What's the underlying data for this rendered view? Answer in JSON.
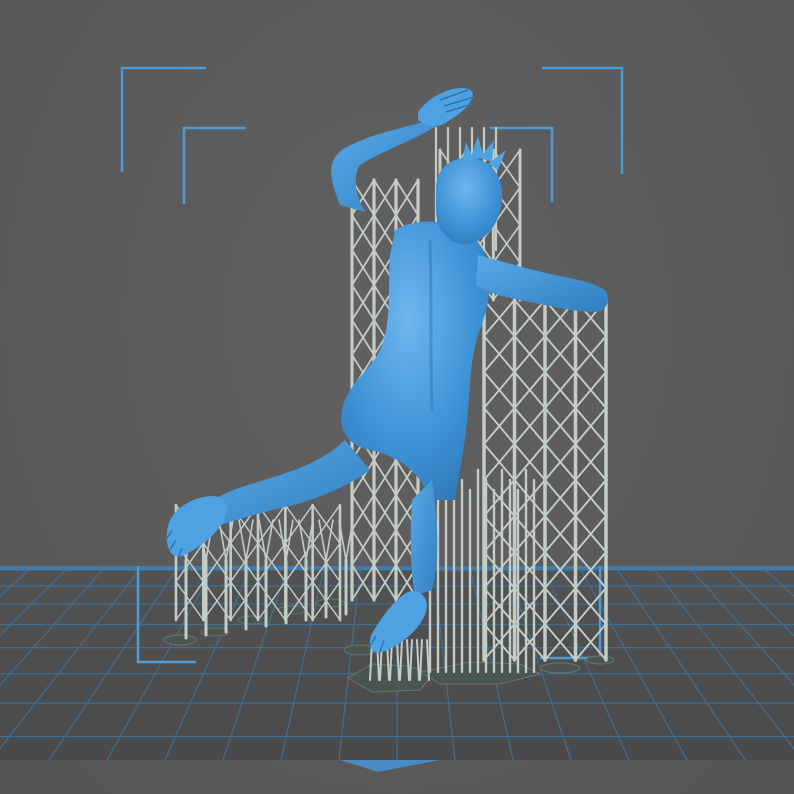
{
  "viewport": {
    "background_color": "#5b5b5b",
    "build_plate_color": "#4e4e4e",
    "grid_line_color": "#3f6f95",
    "model_color": "#3f93d6",
    "support_color": "#c4ccc6",
    "bounding_bracket_color": "#4f9ad1"
  },
  "scene": {
    "model": "figure-on-supports",
    "view": "perspective-back"
  }
}
